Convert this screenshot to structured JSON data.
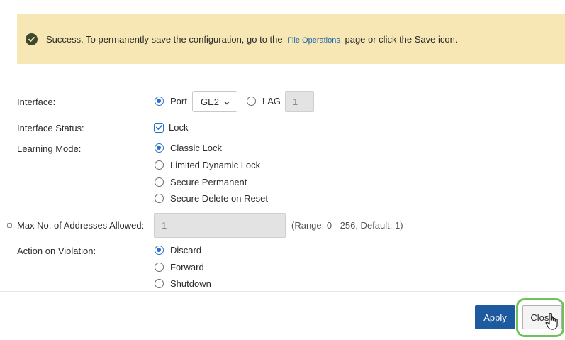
{
  "alert": {
    "text_before": "Success. To permanently save the configuration, go to the",
    "link": "File Operations",
    "text_after": "page or click the Save icon."
  },
  "interface": {
    "label": "Interface:",
    "port_label": "Port",
    "port_selected": true,
    "port_value": "GE2",
    "lag_label": "LAG",
    "lag_selected": false,
    "lag_value": "1"
  },
  "interface_status": {
    "label": "Interface Status:",
    "lock_label": "Lock",
    "lock_checked": true
  },
  "learning_mode": {
    "label": "Learning Mode:",
    "options": [
      {
        "label": "Classic Lock",
        "selected": true
      },
      {
        "label": "Limited Dynamic Lock",
        "selected": false
      },
      {
        "label": "Secure Permanent",
        "selected": false
      },
      {
        "label": "Secure Delete on Reset",
        "selected": false
      }
    ]
  },
  "max_addresses": {
    "label": "Max No. of Addresses Allowed:",
    "value": "1",
    "hint": "(Range: 0 - 256, Default: 1)"
  },
  "action_on_violation": {
    "label": "Action on Violation:",
    "options": [
      {
        "label": "Discard",
        "selected": true
      },
      {
        "label": "Forward",
        "selected": false
      },
      {
        "label": "Shutdown",
        "selected": false
      }
    ]
  },
  "buttons": {
    "apply": "Apply",
    "close": "Close"
  },
  "colors": {
    "alert_bg": "#f7e7b4",
    "accent": "#2a6fc9",
    "apply_bg": "#1d5aa0",
    "close_highlight": "#6fc25a"
  }
}
